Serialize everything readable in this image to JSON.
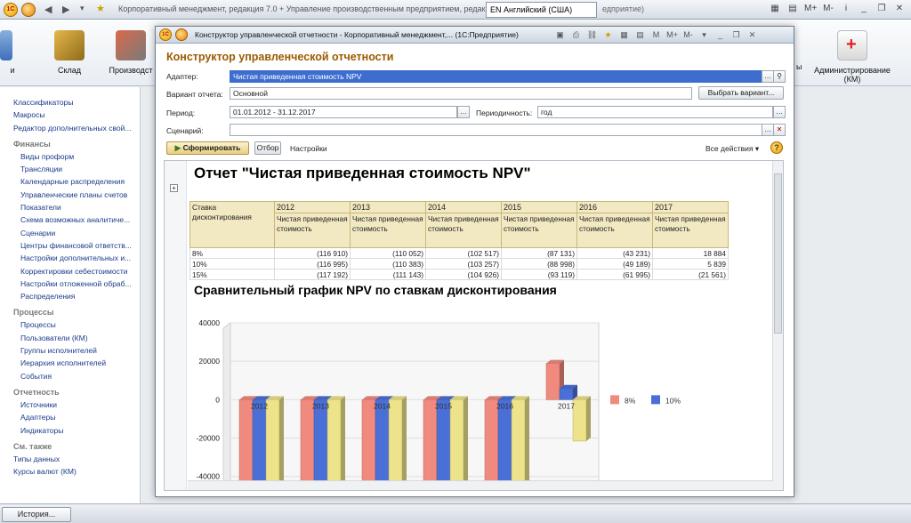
{
  "app": {
    "title": "Корпоративный менеджмент, редакция 7.0 + Управление производственным предприятием, редакция 1.3",
    "language": "EN Английский (США)",
    "language_trail": "едприятие)"
  },
  "sections": [
    {
      "label": "и"
    },
    {
      "label": "Склад"
    },
    {
      "label": "Производст"
    },
    {
      "label": "Администрирование\n(КМ)"
    }
  ],
  "sidebar": {
    "items_top": [
      "Классификаторы",
      "Макросы",
      "Редактор дополнительных свой..."
    ],
    "groups": [
      {
        "title": "Финансы",
        "items": [
          "Виды проформ",
          "Трансляции",
          "Календарные распределения",
          "Управленческие планы счетов",
          "Показатели",
          "Схема возможных аналитиче...",
          "Сценарии",
          "Центры финансовой ответств...",
          "Настройки дополнительных и...",
          "Корректировки себестоимости",
          "Настройки отложенной обраб...",
          "Распределения"
        ]
      },
      {
        "title": "Процессы",
        "items": [
          "Процессы",
          "Пользователи (КМ)",
          "Группы исполнителей",
          "Иерархия исполнителей",
          "События"
        ]
      },
      {
        "title": "Отчетность",
        "items": [
          "Источники",
          "Адаптеры",
          "Индикаторы"
        ]
      },
      {
        "title": "См. также",
        "items": [
          "Типы данных",
          "Курсы валют (КМ)"
        ]
      }
    ]
  },
  "bottom": {
    "history": "История..."
  },
  "dialog": {
    "title": "Конструктор управленческой отчетности - Корпоративный менеджмент,... (1С:Предприятие)",
    "heading": "Конструктор управленческой отчетности",
    "adapter_label": "Адаптер:",
    "adapter_value": "Чистая приведенная стоимость NPV",
    "variant_label": "Вариант отчета:",
    "variant_value": "Основной",
    "choose_variant": "Выбрать вариант...",
    "period_label": "Период:",
    "period_value": "01.01.2012 - 31.12.2017",
    "periodicity_label": "Периодичность:",
    "periodicity_value": "год",
    "scenario_label": "Сценарий:",
    "scenario_value": "",
    "generate": "Сформировать",
    "filter": "Отбор",
    "settings": "Настройки",
    "all_actions": "Все действия",
    "help": "?"
  },
  "report": {
    "title": "Отчет \"Чистая приведенная стоимость NPV\"",
    "rate_header": "Ставка дисконтирования",
    "sub_header": "Чистая приведенная стоимость",
    "years": [
      "2012",
      "2013",
      "2014",
      "2015",
      "2016",
      "2017"
    ],
    "rows": [
      {
        "rate": "8%",
        "values": [
          "(116 910)",
          "(110 052)",
          "(102 517)",
          "(87 131)",
          "(43 231)",
          "18 884"
        ]
      },
      {
        "rate": "10%",
        "values": [
          "(116 995)",
          "(110 383)",
          "(103 257)",
          "(88 998)",
          "(49 189)",
          "5 839"
        ]
      },
      {
        "rate": "15%",
        "values": [
          "(117 192)",
          "(111 143)",
          "(104 926)",
          "(93 119)",
          "(61 995)",
          "(21 561)"
        ]
      }
    ],
    "chart_title": "Сравнительный график NPV по ставкам дисконтирования"
  },
  "chart_data": {
    "type": "bar",
    "title": "Сравнительный график NPV по ставкам дисконтирования",
    "categories": [
      "2012",
      "2013",
      "2014",
      "2015",
      "2016",
      "2017"
    ],
    "series": [
      {
        "name": "8%",
        "color": "#f08a7e",
        "values": [
          -116910,
          -110052,
          -102517,
          -87131,
          -43231,
          18884
        ]
      },
      {
        "name": "10%",
        "color": "#4a6fd6",
        "values": [
          -116995,
          -110383,
          -103257,
          -88998,
          -49189,
          5839
        ]
      },
      {
        "name": "15%",
        "color": "#ece38a",
        "values": [
          -117192,
          -111143,
          -104926,
          -93119,
          -61995,
          -21561
        ]
      }
    ],
    "y_ticks": [
      "40000",
      "20000",
      "0",
      "-20000",
      "-40000"
    ],
    "ylim": [
      -48000,
      40000
    ],
    "legend_position": "right"
  }
}
